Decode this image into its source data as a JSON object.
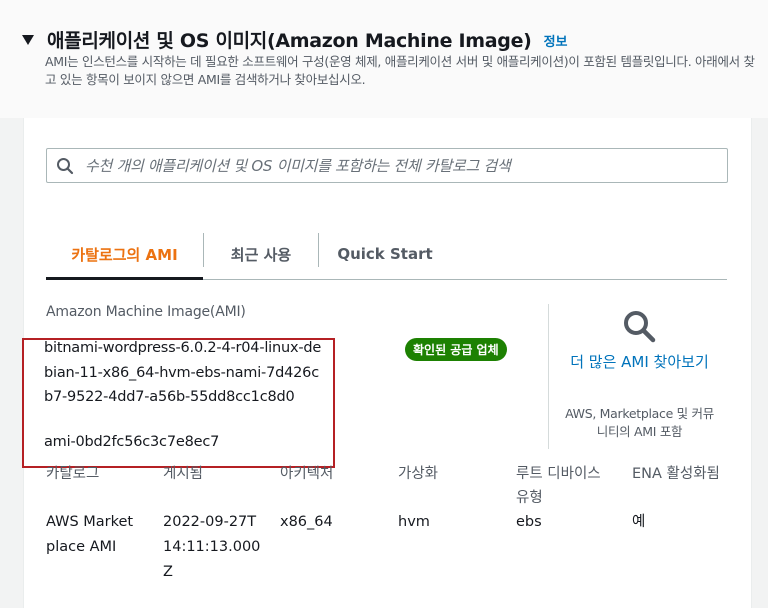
{
  "section": {
    "title": "애플리케이션 및 OS 이미지(Amazon Machine Image)",
    "info_link": "정보",
    "description": "AMI는 인스턴스를 시작하는 데 필요한 소프트웨어 구성(운영 체제, 애플리케이션 서버 및 애플리케이션)이 포함된 템플릿입니다. 아래에서 찾고 있는 항목이 보이지 않으면 AMI를 검색하거나 찾아보십시오."
  },
  "search": {
    "placeholder": "수천 개의 애플리케이션 및 OS 이미지를 포함하는 전체 카탈로그 검색",
    "value": ""
  },
  "tabs": [
    {
      "label": "카탈로그의 AMI",
      "active": true
    },
    {
      "label": "최근 사용",
      "active": false
    },
    {
      "label": "Quick Start",
      "active": false
    }
  ],
  "ami": {
    "section_label": "Amazon Machine Image(AMI)",
    "name": "bitnami-wordpress-6.0.2-4-r04-linux-debian-11-x86_64-hvm-ebs-nami-7d426cb7-9522-4dd7-a56b-55dd8cc1c8d0",
    "id": "ami-0bd2fc56c3c7e8ec7",
    "verified_badge": "확인된 공급 업체"
  },
  "more_ami": {
    "link": "더 많은 AMI 찾아보기",
    "description": "AWS, Marketplace 및 커뮤니티의 AMI 포함",
    "icon": "search-icon"
  },
  "attributes": [
    {
      "label": "카탈로그",
      "value": "AWS Marketplace AMI"
    },
    {
      "label": "게시됨",
      "value": "2022-09-27T14:11:13.000Z"
    },
    {
      "label": "아키텍처",
      "value": "x86_64"
    },
    {
      "label": "가상화",
      "value": "hvm"
    },
    {
      "label": "루트 디바이스 유형",
      "value": "ebs"
    },
    {
      "label": "ENA 활성화됨",
      "value": "예"
    }
  ],
  "colors": {
    "accent": "#ec7211",
    "link": "#0073bb",
    "badge": "#1d8102",
    "highlight_border": "#b52024"
  }
}
